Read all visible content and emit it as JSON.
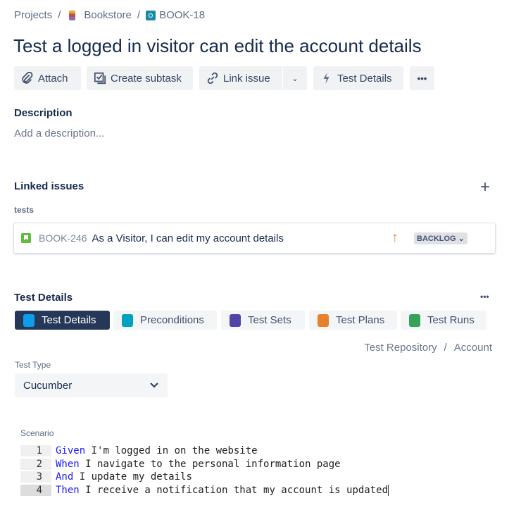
{
  "breadcrumb": {
    "projects": "Projects",
    "sep": "/",
    "project": "Bookstore",
    "issue": "BOOK-18"
  },
  "title": "Test a logged in visitor can edit the account details",
  "toolbar": {
    "attach": "Attach",
    "create_subtask": "Create subtask",
    "link_issue": "Link issue",
    "test_details": "Test Details",
    "more": "•••"
  },
  "description": {
    "heading": "Description",
    "placeholder": "Add a description..."
  },
  "linked_issues": {
    "heading": "Linked issues",
    "add": "+",
    "relation": "tests",
    "items": [
      {
        "key": "BOOK-246",
        "summary": "As a Visitor, I can edit my account details",
        "priority": "↑",
        "status": "BACKLOG"
      }
    ]
  },
  "test_details": {
    "heading": "Test Details",
    "more": "•••",
    "tabs": [
      {
        "label": "Test Details",
        "color": "#0c9ee8"
      },
      {
        "label": "Preconditions",
        "color": "#00a3bf"
      },
      {
        "label": "Test Sets",
        "color": "#5243aa"
      },
      {
        "label": "Test Plans",
        "color": "#e8822a"
      },
      {
        "label": "Test Runs",
        "color": "#36a15a"
      }
    ],
    "repository": "Test Repository",
    "repo_sep": "/",
    "folder": "Account",
    "test_type_label": "Test Type",
    "test_type": "Cucumber",
    "scenario_label": "Scenario",
    "lines": [
      {
        "n": "1",
        "kw": "Given",
        "rest": " I'm logged in on the website"
      },
      {
        "n": "2",
        "kw": "When",
        "rest": " I navigate to the personal information page"
      },
      {
        "n": "3",
        "kw": "And",
        "rest": " I update my details"
      },
      {
        "n": "4",
        "kw": "Then",
        "rest": " I receive a notification that my account is updated"
      }
    ]
  }
}
